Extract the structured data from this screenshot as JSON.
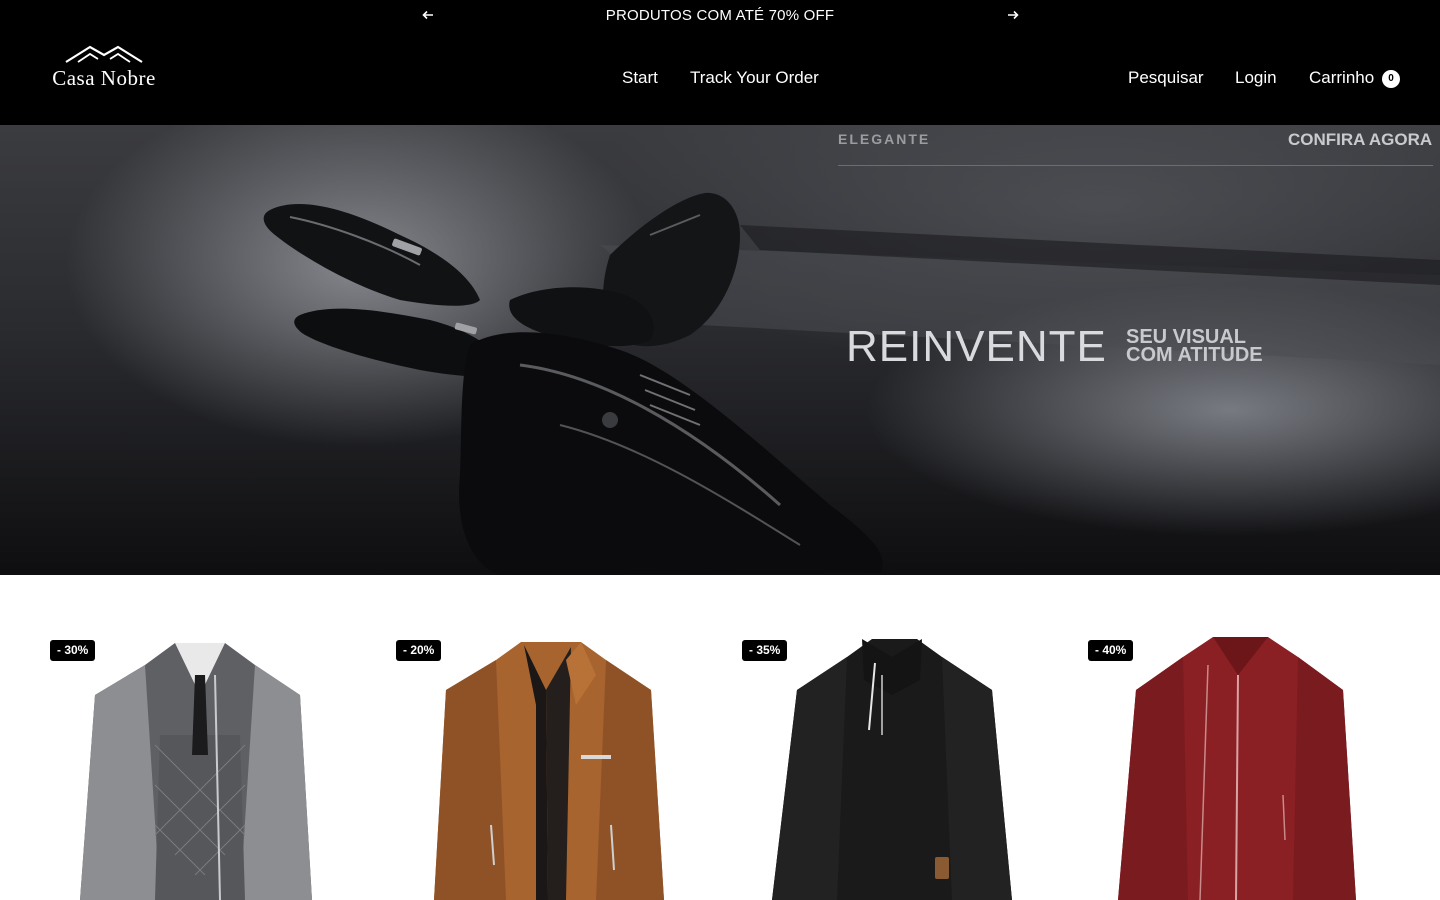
{
  "announcement": {
    "message": "PRODUTOS COM ATÉ 70% OFF",
    "prev_icon": "arrow-left-icon",
    "next_icon": "arrow-right-icon"
  },
  "header": {
    "logo_text": "Casa Nobre",
    "nav_center": [
      {
        "label": "Start"
      },
      {
        "label": "Track Your Order"
      }
    ],
    "nav_right": {
      "search": "Pesquisar",
      "login": "Login",
      "cart": "Carrinho",
      "cart_count": "0"
    }
  },
  "hero": {
    "top_label": "ELEGANTE",
    "cta": "CONFIRA AGORA",
    "headline": "REINVENTE",
    "tagline_line1": "SEU VISUAL",
    "tagline_line2": "COM ATITUDE"
  },
  "products": [
    {
      "badge": "- 30%",
      "image": "gray-quilted-jacket",
      "color": "#6d6f73"
    },
    {
      "badge": "- 20%",
      "image": "brown-leather-jacket",
      "color": "#a86530"
    },
    {
      "badge": "- 35%",
      "image": "black-quarter-zip-sweater",
      "color": "#1c1c1c"
    },
    {
      "badge": "- 40%",
      "image": "red-knit-jacket",
      "color": "#8a1f24"
    }
  ],
  "colors": {
    "header_bg": "#000000",
    "text_light": "#ffffff",
    "page_bg": "#ffffff"
  }
}
